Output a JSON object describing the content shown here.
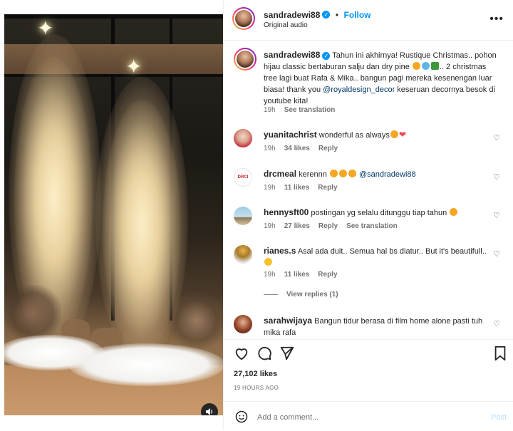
{
  "post": {
    "author": "sandradewi88",
    "follow_label": "Follow",
    "audio": "Original audio",
    "caption": "Tahun ini akhirnya! Rustique Christmas.. pohon hijau classic bertaburan salju dan dry pine ",
    "caption_part2": ".. 2 christmas tree lagi buat Rafa & Mika.. bangun pagi mereka kesenengan luar biasa! thank you ",
    "caption_mention": "@royaldesign_decor",
    "caption_part3": " keseruan decornya besok di youtube kita!",
    "caption_time": "19h",
    "see_translation": "See translation",
    "likes": "27,102 likes",
    "time_ago": "19 HOURS AGO"
  },
  "comments": [
    {
      "user": "yuanitachrist",
      "text": "wonderful as always",
      "time": "19h",
      "likes": "34 likes",
      "reply": "Reply"
    },
    {
      "user": "drcmeal",
      "text": "kerennn ",
      "mention": "@sandradewi88",
      "time": "19h",
      "likes": "11 likes",
      "reply": "Reply"
    },
    {
      "user": "hennysft00",
      "text": "postingan yg selalu ditunggu tiap tahun",
      "time": "19h",
      "likes": "27 likes",
      "reply": "Reply",
      "translation": "See translation"
    },
    {
      "user": "rianes.s",
      "text": "Asal ada duit.. Semua hal bs diatur.. But it's beautifull..",
      "time": "19h",
      "likes": "11 likes",
      "reply": "Reply",
      "view_replies": "View replies (1)"
    },
    {
      "user": "sarahwijaya",
      "text": "Bangun tidur berasa di film home alone pasti tuh mika rafa"
    }
  ],
  "add_comment": {
    "placeholder": "Add a comment...",
    "post_label": "Post"
  },
  "avatar_labels": {
    "drcmeal": "DRCI"
  },
  "icons": [
    "more-icon",
    "heart-icon",
    "comment-icon",
    "share-icon",
    "bookmark-icon",
    "emoji-icon",
    "volume-icon",
    "verified-icon"
  ],
  "colors": {
    "accent": "#0095f6",
    "mention": "#00376b",
    "muted": "#737373",
    "like_red": "#ed4956"
  }
}
